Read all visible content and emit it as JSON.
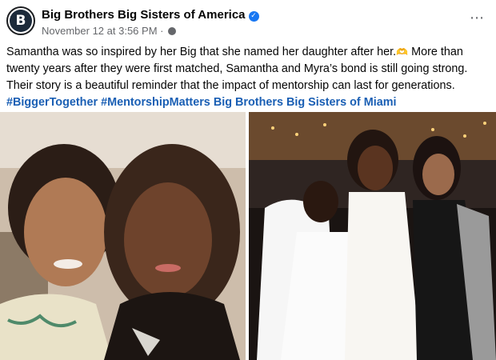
{
  "post": {
    "page_name": "Big Brothers Big Sisters of America",
    "avatar_letter": "B",
    "timestamp": "November 12 at 3:56 PM",
    "separator": "·",
    "more_icon": "⋯",
    "caption_text": "Samantha was so inspired by her Big that she named her daughter after her.",
    "emoji": "🫶",
    "caption_text_2": " More than twenty years after they were first matched, Samantha and Myra’s bond is still going strong. Their story is a beautiful reminder that the impact of mentorship can last for generations.",
    "hashtags": [
      "#BiggerTogether",
      "#MentorshipMatters",
      "Big Brothers Big Sisters of Miami"
    ]
  },
  "colors": {
    "link": "#1a5fb4",
    "verified": "#1877f2",
    "meta": "#65676b"
  },
  "icons": [
    "verified-badge-icon",
    "globe-icon",
    "more-options-icon"
  ]
}
